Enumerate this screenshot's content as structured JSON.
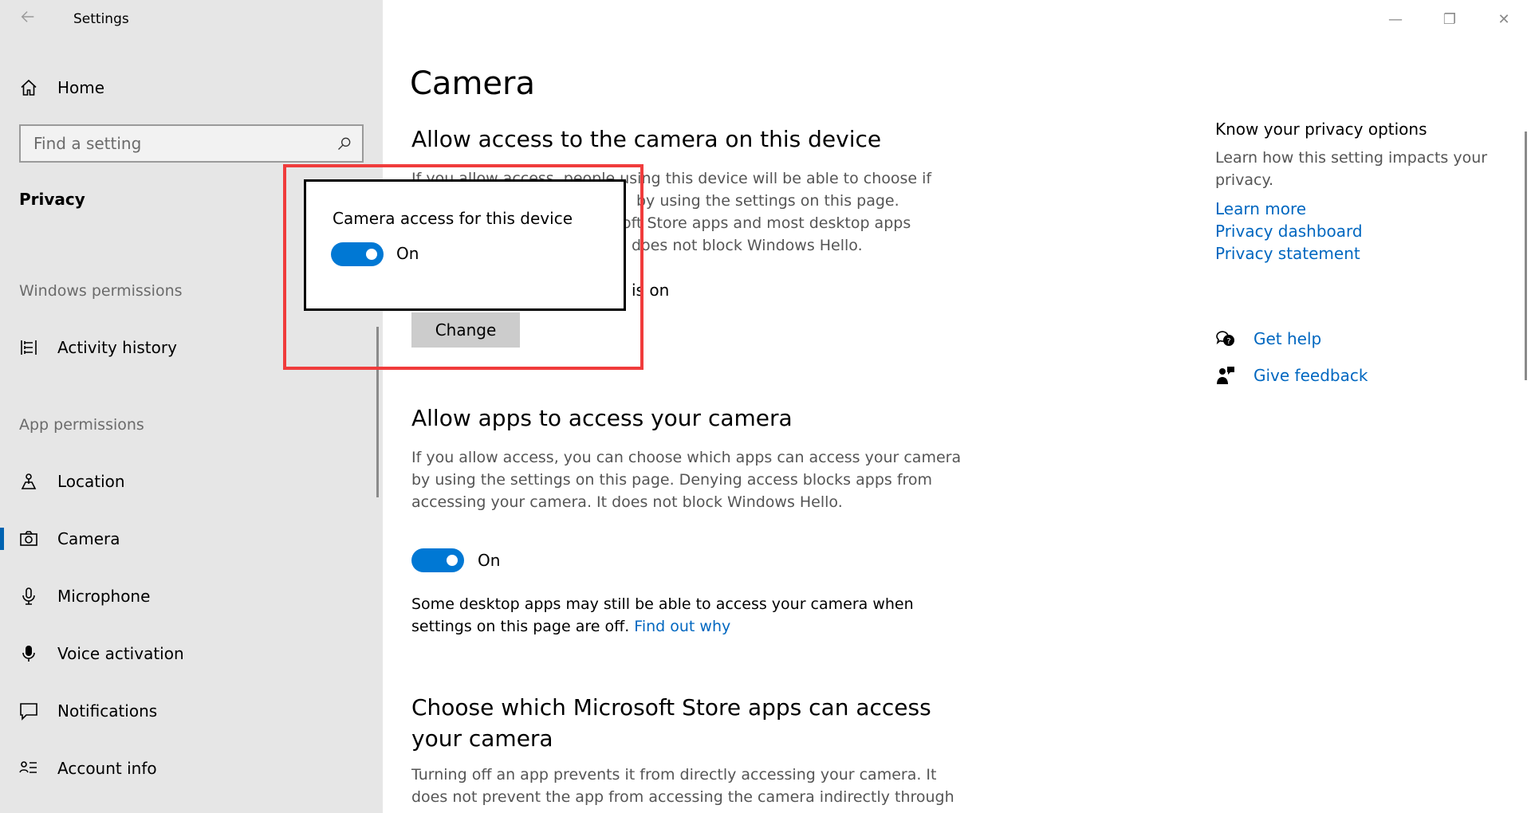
{
  "window": {
    "app_title": "Settings",
    "back_icon": "back-arrow-icon",
    "minimize_glyph": "—",
    "restore_glyph": "❐",
    "close_glyph": "✕"
  },
  "sidebar": {
    "home_label": "Home",
    "search_placeholder": "Find a setting",
    "section_title": "Privacy",
    "windows_permissions_label": "Windows permissions",
    "app_permissions_label": "App permissions",
    "items": [
      {
        "label": "Activity history",
        "icon": "activity-history-icon"
      },
      {
        "label": "Location",
        "icon": "location-icon"
      },
      {
        "label": "Camera",
        "icon": "camera-icon",
        "selected": true
      },
      {
        "label": "Microphone",
        "icon": "microphone-icon"
      },
      {
        "label": "Voice activation",
        "icon": "voice-activation-icon"
      },
      {
        "label": "Notifications",
        "icon": "notifications-icon"
      },
      {
        "label": "Account info",
        "icon": "account-info-icon"
      }
    ]
  },
  "main": {
    "page_title": "Camera",
    "device_section": {
      "heading": "Allow access to the camera on this device",
      "line1": "If you allow access, people using this device will be able to choose if",
      "line2_frag": "by using the settings on this page.",
      "line3_frag": "oft Store apps and most desktop apps",
      "line4_frag": "does not block Windows Hello.",
      "status_frag": "is on",
      "change_label": "Change"
    },
    "apps_section": {
      "heading": "Allow apps to access your camera",
      "description": "If you allow access, you can choose which apps can access your camera by using the settings on this page. Denying access blocks apps from accessing your camera. It does not block Windows Hello.",
      "toggle_state": "On",
      "note": "Some desktop apps may still be able to access your camera when settings on this page are off.",
      "note_link": "Find out why"
    },
    "store_section": {
      "heading": "Choose which Microsoft Store apps can access your camera",
      "description": "Turning off an app prevents it from directly accessing your camera. It does not prevent the app from accessing the camera indirectly through"
    }
  },
  "right_column": {
    "heading": "Know your privacy options",
    "description": "Learn how this setting impacts your privacy.",
    "links": [
      "Learn more",
      "Privacy dashboard",
      "Privacy statement"
    ],
    "get_help": "Get help",
    "give_feedback": "Give feedback"
  },
  "flyout": {
    "title": "Camera access for this device",
    "toggle_state": "On"
  },
  "colors": {
    "accent": "#0078d4",
    "link": "#0067c0",
    "highlight": "#f03c3c",
    "sidebar_bg": "#e6e6e6"
  }
}
